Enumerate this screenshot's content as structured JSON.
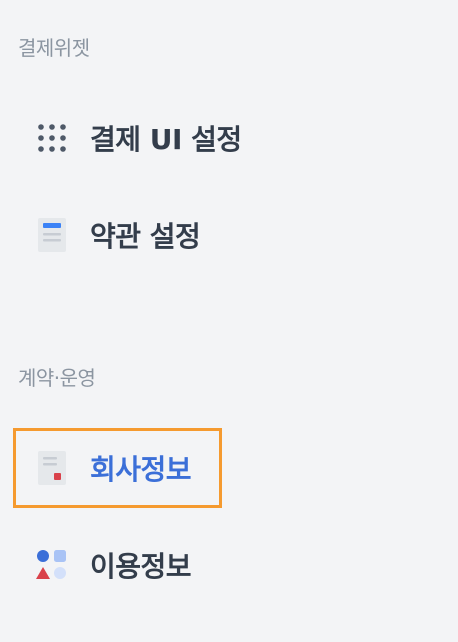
{
  "sections": [
    {
      "title": "결제위젯",
      "items": [
        {
          "label": "결제 UI 설정",
          "icon": "grid-dots-icon"
        },
        {
          "label": "약관 설정",
          "icon": "document-icon"
        }
      ]
    },
    {
      "title": "계약·운영",
      "items": [
        {
          "label": "회사정보",
          "icon": "company-document-icon",
          "active": true
        },
        {
          "label": "이용정보",
          "icon": "shapes-icon"
        }
      ]
    }
  ],
  "colors": {
    "background": "#f3f4f6",
    "section_title": "#8b95a1",
    "item_text": "#333d4b",
    "active_text": "#3b6fd8",
    "highlight_border": "#f59a2f"
  }
}
